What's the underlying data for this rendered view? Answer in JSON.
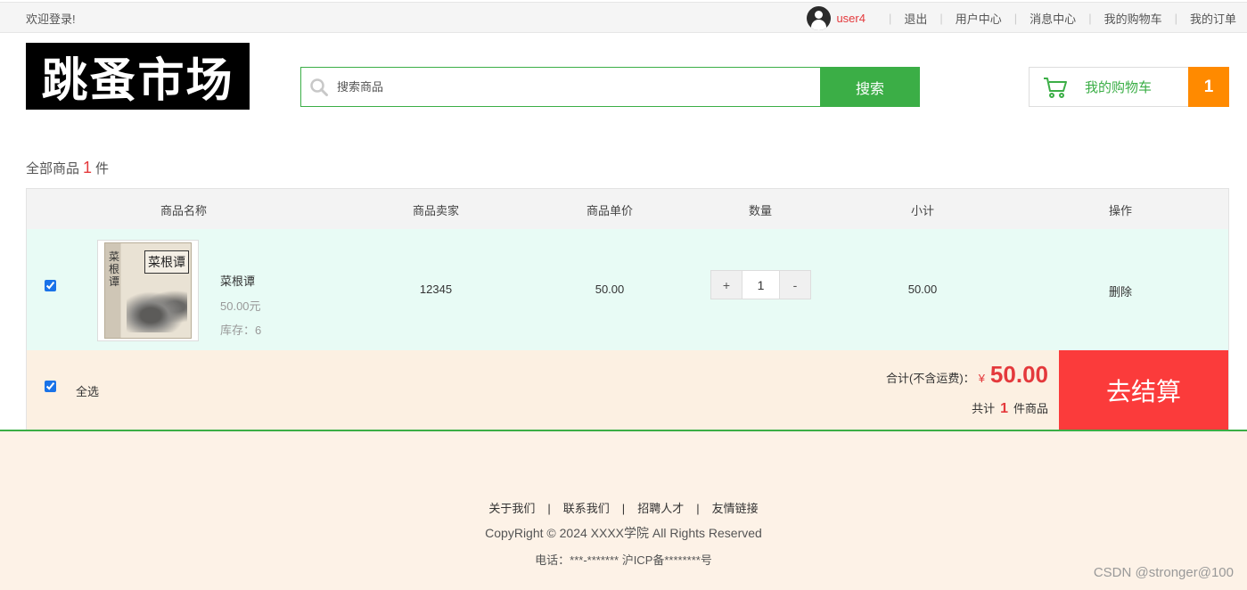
{
  "topbar": {
    "welcome": "欢迎登录!",
    "username": "user4",
    "links": [
      "退出",
      "用户中心",
      "消息中心",
      "我的购物车",
      "我的订单"
    ]
  },
  "header": {
    "logo_text": "跳蚤市场",
    "search_placeholder": "搜索商品",
    "search_button": "搜索",
    "cart_label": "我的购物车",
    "cart_count": "1"
  },
  "summary_line": {
    "prefix": "全部商品",
    "count": "1",
    "suffix": "件"
  },
  "table": {
    "headers": [
      "商品名称",
      "商品卖家",
      "商品单价",
      "数量",
      "小计",
      "操作"
    ],
    "rows": [
      {
        "name": "菜根谭",
        "price_text": "50.00元",
        "stock_text": "库存：6",
        "seller": "12345",
        "unit_price": "50.00",
        "quantity": "1",
        "subtotal": "50.00",
        "action": "删除",
        "cover_title": "菜根谭",
        "checked": true
      }
    ]
  },
  "checkout_bar": {
    "select_all": "全选",
    "total_label": "合计(不含运费)：",
    "currency": "¥",
    "total_amount": "50.00",
    "count_prefix": "共计",
    "count": "1",
    "count_suffix": "件商品",
    "checkout_button": "去结算"
  },
  "footer": {
    "links": [
      "关于我们",
      "联系我们",
      "招聘人才",
      "友情链接"
    ],
    "copyright": "CopyRight © 2024 XXXX学院 All Rights Reserved",
    "phone": "电话：***-******* 沪ICP备********号",
    "watermark": "CSDN @stronger@100"
  },
  "colors": {
    "brand_green": "#3bae46",
    "accent_red": "#e4393c",
    "cart_badge": "#ff8a00",
    "checkout_button": "#fb3b3b"
  }
}
